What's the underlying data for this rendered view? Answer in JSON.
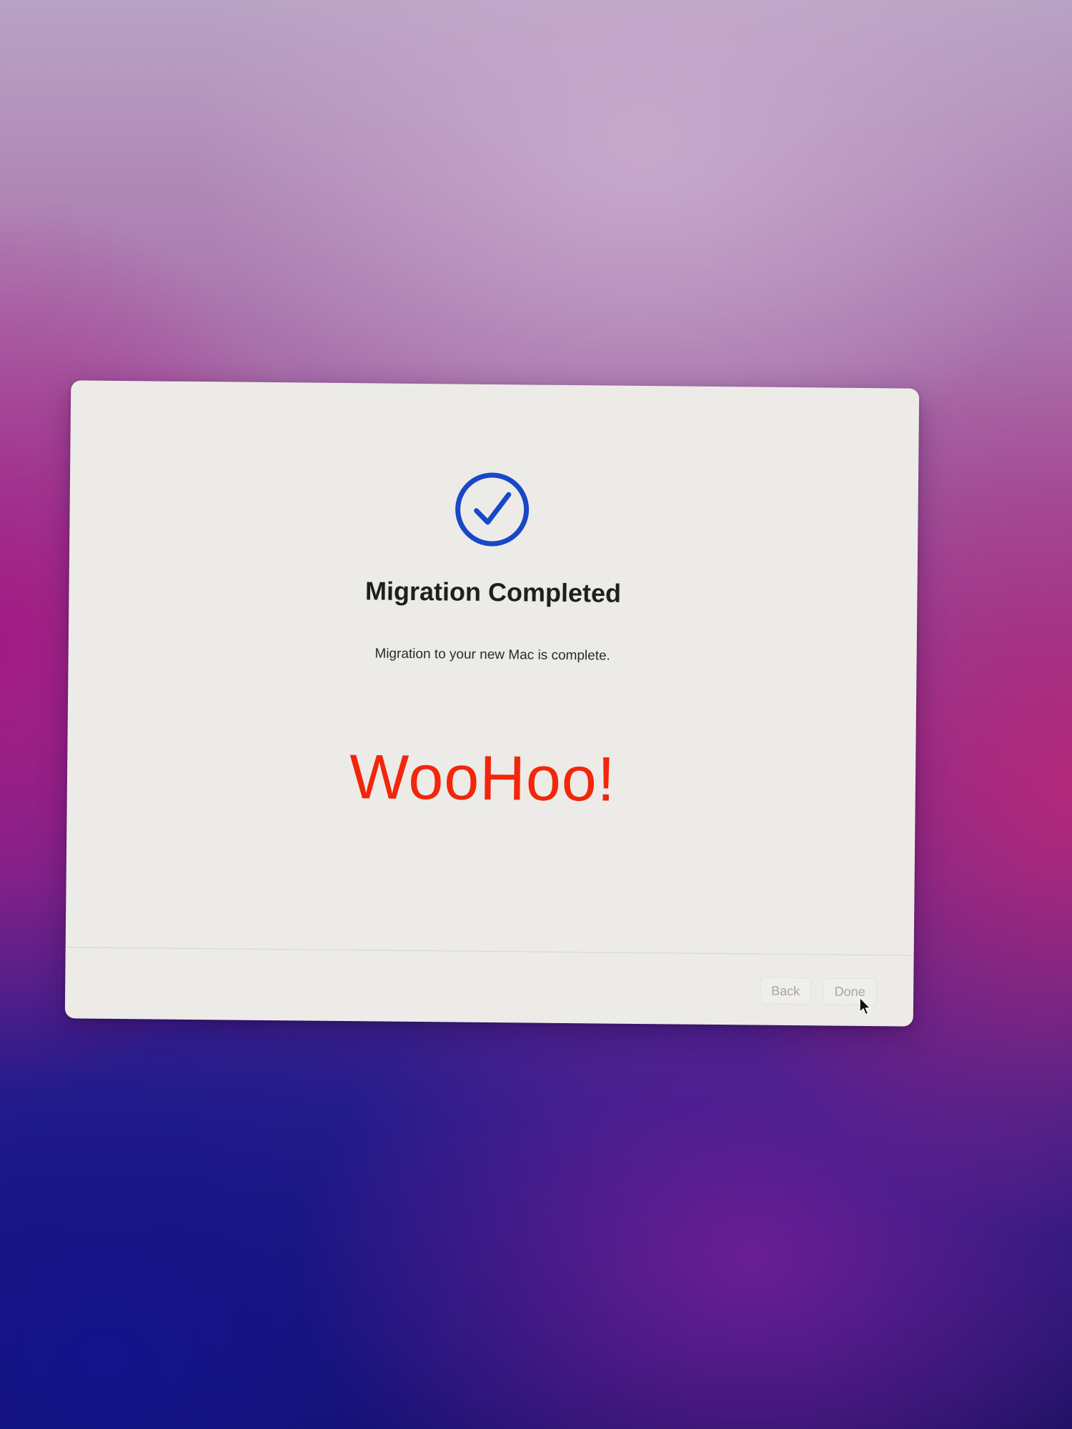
{
  "dialog": {
    "icon": "checkmark-circle-icon",
    "title": "Migration Completed",
    "message": "Migration to your new Mac is complete.",
    "overlay_text": "WooHoo!",
    "buttons": {
      "back_label": "Back",
      "done_label": "Done"
    }
  },
  "colors": {
    "accent": "#1848c8",
    "overlay_text": "#f2260b",
    "dialog_background": "#ecebe8",
    "disabled_button_text": "#a7a6a3"
  },
  "pointer": "arrow-cursor-icon"
}
